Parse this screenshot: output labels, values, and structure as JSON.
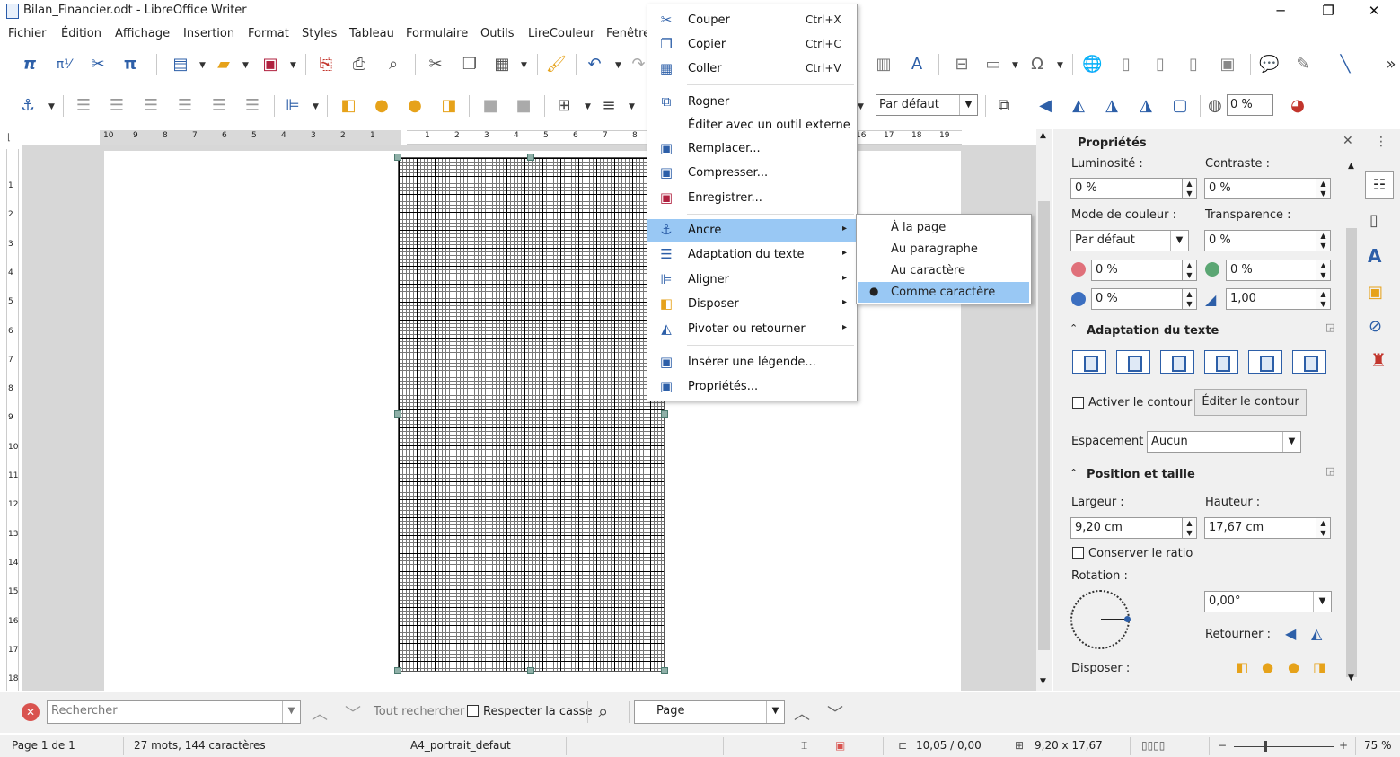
{
  "window": {
    "title": "Bilan_Financier.odt - LibreOffice Writer",
    "minimize": "─",
    "restore": "❐",
    "close": "✕"
  },
  "menu": [
    "Fichier",
    "Édition",
    "Affichage",
    "Insertion",
    "Format",
    "Styles",
    "Tableau",
    "Formulaire",
    "Outils",
    "LireCouleur",
    "Fenêtre"
  ],
  "toolbar": {
    "preset_select": "Par défaut",
    "transparency_value": "0 %"
  },
  "ruler": {
    "h_labels_left": [
      "10",
      "9",
      "8",
      "7",
      "6",
      "5",
      "4",
      "3",
      "2",
      "1"
    ],
    "h_labels_right": [
      "1",
      "2",
      "3",
      "4",
      "5",
      "6",
      "7",
      "8"
    ],
    "h_labels_far": [
      "16",
      "17",
      "18",
      "19"
    ],
    "v_labels": [
      "1",
      "2",
      "3",
      "4",
      "5",
      "6",
      "7",
      "8",
      "9",
      "10",
      "11",
      "12",
      "13",
      "14",
      "15",
      "16",
      "17",
      "18"
    ]
  },
  "context_menu": {
    "items": [
      {
        "label": "Couper",
        "shortcut": "Ctrl+X",
        "icon": "scissors-icon"
      },
      {
        "label": "Copier",
        "shortcut": "Ctrl+C",
        "icon": "copy-icon"
      },
      {
        "label": "Coller",
        "shortcut": "Ctrl+V",
        "icon": "paste-icon"
      },
      {
        "label": "Rogner",
        "icon": "crop-icon"
      },
      {
        "label": "Éditer avec un outil externe"
      },
      {
        "label": "Remplacer...",
        "icon": "replace-image-icon"
      },
      {
        "label": "Compresser...",
        "icon": "compress-image-icon"
      },
      {
        "label": "Enregistrer...",
        "icon": "save-icon"
      },
      {
        "label": "Ancre",
        "icon": "anchor-icon",
        "submenu": true
      },
      {
        "label": "Adaptation du texte",
        "icon": "wrap-icon",
        "submenu": true
      },
      {
        "label": "Aligner",
        "icon": "align-icon",
        "submenu": true
      },
      {
        "label": "Disposer",
        "icon": "arrange-icon",
        "submenu": true
      },
      {
        "label": "Pivoter ou retourner",
        "icon": "rotate-icon",
        "submenu": true
      },
      {
        "label": "Insérer une légende...",
        "icon": "caption-icon"
      },
      {
        "label": "Propriétés...",
        "icon": "properties-icon"
      }
    ]
  },
  "submenu": [
    "À la page",
    "Au paragraphe",
    "Au caractère",
    "Comme caractère"
  ],
  "sidebar": {
    "title": "Propriétés",
    "luminosite_label": "Luminosité :",
    "luminosite_value": "0 %",
    "contraste_label": "Contraste :",
    "contraste_value": "0 %",
    "mode_label": "Mode de couleur :",
    "mode_value": "Par défaut",
    "transparence_label": "Transparence :",
    "transparence_value": "0 %",
    "red_value": "0 %",
    "green_value": "0 %",
    "blue_value": "0 %",
    "gamma_value": "1,00",
    "wrap_section": "Adaptation du texte",
    "contour_checkbox": "Activer le contour",
    "contour_button": "Éditer le contour",
    "spacing_label": "Espacement :",
    "spacing_value": "Aucun",
    "pos_section": "Position et taille",
    "width_label": "Largeur :",
    "width_value": "9,20 cm",
    "height_label": "Hauteur :",
    "height_value": "17,67 cm",
    "ratio_checkbox": "Conserver le ratio",
    "rotation_label": "Rotation :",
    "rotation_value": "0,00°",
    "flip_label": "Retourner :",
    "arrange_label": "Disposer :"
  },
  "findbar": {
    "search_placeholder": "Rechercher",
    "find_all": "Tout rechercher",
    "match_case": "Respecter la casse",
    "scope": "Page"
  },
  "status": {
    "page": "Page 1 de 1",
    "words": "27 mots, 144 caractères",
    "style": "A4_portrait_defaut",
    "position": "10,05 / 0,00",
    "size": "9,20 x 17,67",
    "zoom": "75 %"
  },
  "colors": {
    "accent": "#2d5fa8",
    "highlight": "#99c8f4"
  }
}
